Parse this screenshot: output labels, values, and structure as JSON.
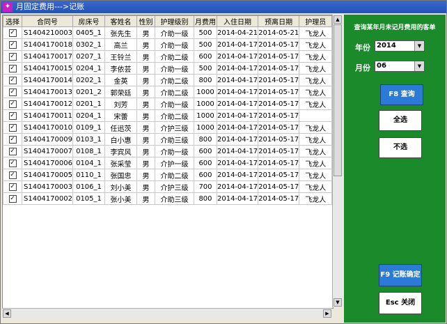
{
  "window": {
    "title": "月固定费用--->记账",
    "icon": "app-icon"
  },
  "table": {
    "columns": [
      "选择",
      "合同号",
      "房床号",
      "客姓名",
      "性别",
      "护理级别",
      "月费用",
      "入住日期",
      "预离日期",
      "护理员"
    ],
    "rows": [
      [
        "S1404210003",
        "0405_1",
        "张先生",
        "男",
        "介助一级",
        "500",
        "2014-04-21",
        "2014-05-21",
        "飞龙人"
      ],
      [
        "S1404170018",
        "0302_1",
        "高兰",
        "男",
        "介助一级",
        "500",
        "2014-04-17",
        "2014-05-17",
        "飞龙人"
      ],
      [
        "S1404170017",
        "0207_1",
        "王铃兰",
        "男",
        "介助二级",
        "600",
        "2014-04-17",
        "2014-05-17",
        "飞龙人"
      ],
      [
        "S1404170015",
        "0204_1",
        "李依芸",
        "男",
        "介助一级",
        "500",
        "2014-04-17",
        "2014-05-17",
        "飞龙人"
      ],
      [
        "S1404170014",
        "0202_1",
        "金英",
        "男",
        "介助二级",
        "800",
        "2014-04-17",
        "2014-05-17",
        "飞龙人"
      ],
      [
        "S1404170013",
        "0201_2",
        "郭荣廷",
        "男",
        "介助二级",
        "1000",
        "2014-04-17",
        "2014-05-17",
        "飞龙人"
      ],
      [
        "S1404170012",
        "0201_1",
        "刘芳",
        "男",
        "介助一级",
        "1000",
        "2014-04-17",
        "2014-05-17",
        "飞龙人"
      ],
      [
        "S1404170011",
        "0204_1",
        "宋蕾",
        "男",
        "介助二级",
        "1000",
        "2014-04-17",
        "2014-05-17",
        ""
      ],
      [
        "S1404170010",
        "0109_1",
        "任迅茨",
        "男",
        "介护三级",
        "1000",
        "2014-04-17",
        "2014-05-17",
        "飞龙人"
      ],
      [
        "S1404170009",
        "0103_1",
        "白小惠",
        "男",
        "介助三级",
        "800",
        "2014-04-17",
        "2014-05-17",
        "飞龙人"
      ],
      [
        "S1404170007",
        "0108_1",
        "李宾风",
        "男",
        "介助一级",
        "600",
        "2014-04-17",
        "2014-05-17",
        "飞龙人"
      ],
      [
        "S1404170006",
        "0104_1",
        "张采莹",
        "男",
        "介护一级",
        "600",
        "2014-04-17",
        "2014-05-17",
        "飞龙人"
      ],
      [
        "S1404170005",
        "0110_1",
        "张国忠",
        "男",
        "介助二级",
        "600",
        "2014-04-17",
        "2014-05-17",
        "飞龙人"
      ],
      [
        "S1404170003",
        "0106_1",
        "刘小美",
        "男",
        "介护三级",
        "700",
        "2014-04-17",
        "2014-05-17",
        "飞龙人"
      ],
      [
        "S1404170002",
        "0105_1",
        "张小美",
        "男",
        "介助三级",
        "800",
        "2014-04-17",
        "2014-05-17",
        "飞龙人"
      ]
    ],
    "checked_mark": "✓"
  },
  "panel": {
    "heading": "查询某年月未记月费用的客单",
    "year_label": "年份",
    "year_value": "2014",
    "month_label": "月份",
    "month_value": "06",
    "query_button": "F8 查询",
    "select_all_button": "全选",
    "deselect_button": "不选",
    "confirm_button": "F9 记账确定",
    "close_button": "Esc 关闭"
  },
  "colors": {
    "panel_bg": "#1a8a2a",
    "accent_button": "#2b7bd6",
    "titlebar": "#2453b8"
  }
}
